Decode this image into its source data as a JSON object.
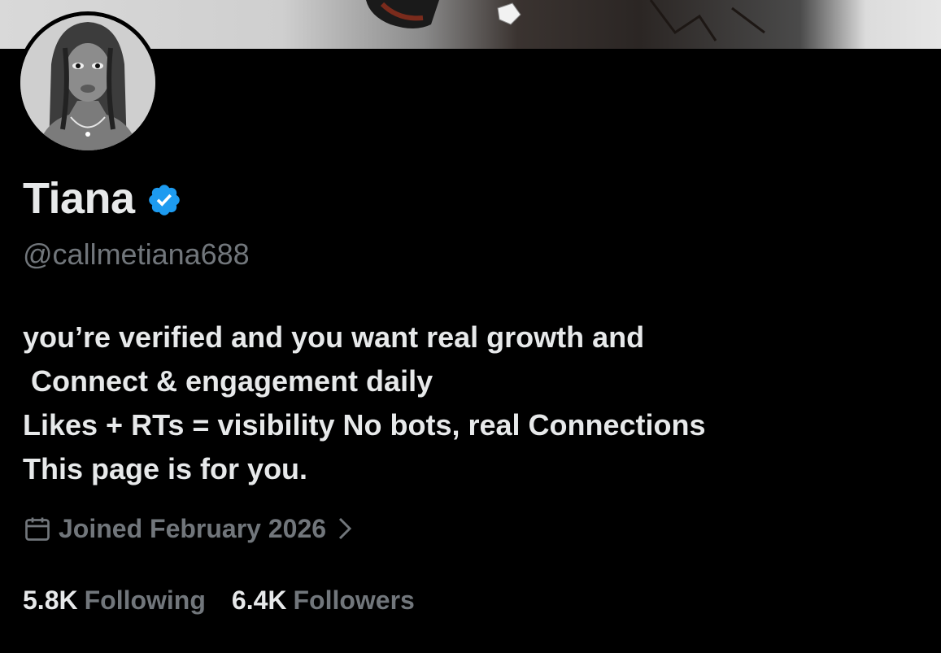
{
  "banner": {
    "icon": "profile-banner-image"
  },
  "avatar": {
    "icon": "profile-avatar-illustration"
  },
  "profile": {
    "display_name": "Tiana",
    "verified": true,
    "verified_color": "#1d9bf0",
    "handle": "@callmetiana688",
    "bio_lines": [
      "you’re verified and you want real growth and",
      " Connect & engagement daily",
      "Likes + RTs = visibility No bots, real Connections",
      "This page is for you."
    ],
    "joined": "Joined February 2026"
  },
  "stats": {
    "following_count": "5.8K",
    "following_label": "Following",
    "followers_count": "6.4K",
    "followers_label": "Followers"
  },
  "colors": {
    "background": "#000000",
    "text_primary": "#e7e9ea",
    "text_secondary": "#71767b",
    "accent": "#1d9bf0"
  }
}
